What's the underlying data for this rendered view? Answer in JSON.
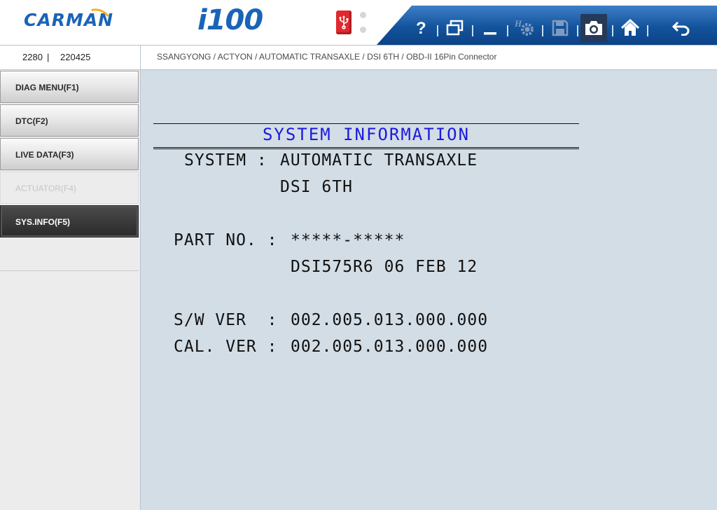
{
  "header": {
    "brand": "CARMAN",
    "model": "i100",
    "toolbar_icons": [
      "help-icon",
      "window-icon",
      "minimize-icon",
      "settings-icon",
      "save-icon",
      "camera-icon",
      "home-icon",
      "back-icon"
    ]
  },
  "infobar": {
    "serial_a": "2280",
    "serial_sep": "|",
    "serial_b": "220425",
    "breadcrumb": "SSANGYONG / ACTYON / AUTOMATIC TRANSAXLE / DSI 6TH / OBD-II 16Pin Connector"
  },
  "sidebar": {
    "items": [
      {
        "label": "DIAG MENU(F1)",
        "state": "normal"
      },
      {
        "label": "DTC(F2)",
        "state": "normal"
      },
      {
        "label": "LIVE DATA(F3)",
        "state": "normal"
      },
      {
        "label": "ACTUATOR(F4)",
        "state": "disabled"
      },
      {
        "label": "SYS.INFO(F5)",
        "state": "selected"
      }
    ]
  },
  "content": {
    "title": "SYSTEM INFORMATION",
    "system_label": "SYSTEM :",
    "system_value1": "AUTOMATIC TRANSAXLE",
    "system_value2": "DSI 6TH",
    "part_label": "PART NO. :",
    "part_value1": "*****-*****",
    "part_value2": "DSI575R6 06 FEB 12",
    "sw_label": "S/W VER  :",
    "sw_value": "002.005.013.000.000",
    "cal_label": "CAL. VER :",
    "cal_value": "002.005.013.000.000"
  },
  "colors": {
    "brand_blue": "#1a64b8",
    "title_blue": "#1a1ae0",
    "usb_red": "#e0282e",
    "content_bg": "#d3dde5"
  }
}
